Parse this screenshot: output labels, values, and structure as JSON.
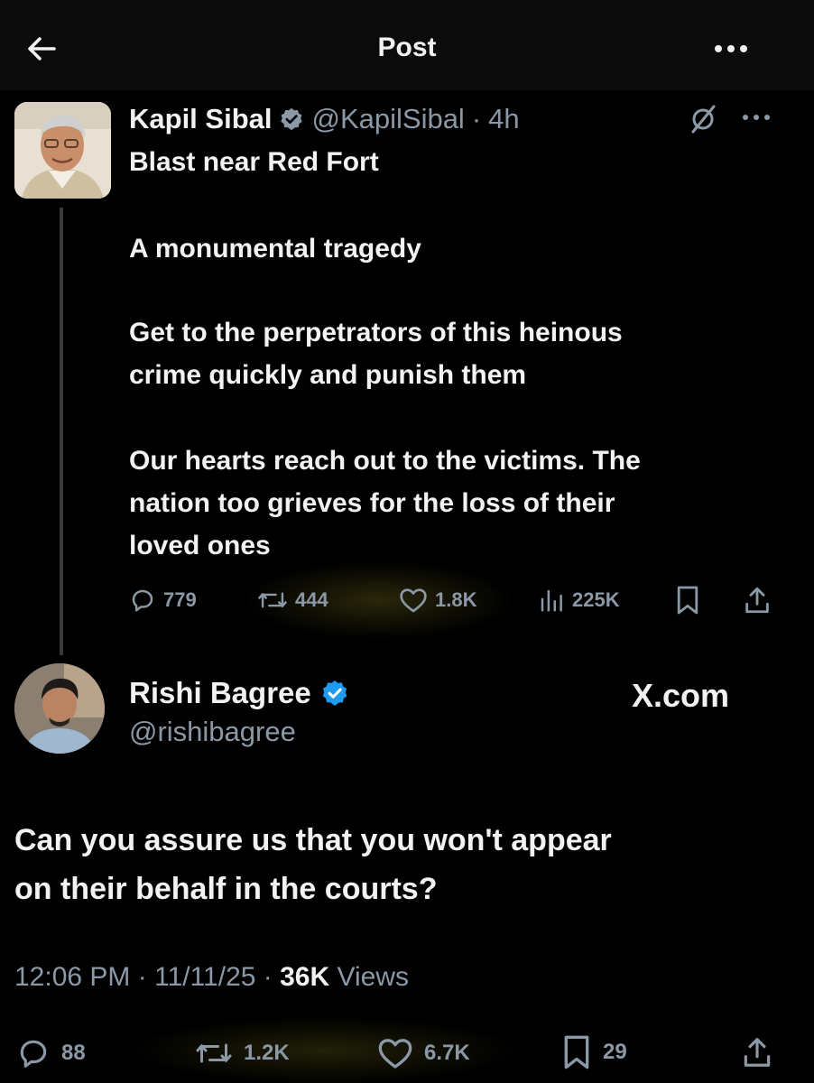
{
  "header": {
    "title": "Post"
  },
  "quoted_post": {
    "author_name": "Kapil Sibal",
    "handle": "@KapilSibal",
    "separator": "·",
    "time": "4h",
    "lines": [
      "Blast near Red Fort",
      "A monumental tragedy",
      "Get to the perpetrators of this heinous",
      "crime quickly and punish them",
      "Our hearts reach out to the victims. The",
      "nation too grieves for the loss of their",
      "loved ones"
    ],
    "actions": {
      "replies": "779",
      "reposts": "444",
      "likes": "1.8K",
      "views": "225K"
    },
    "accent_color": "#1d9bf0"
  },
  "reply_post": {
    "author_name": "Rishi Bagree",
    "handle": "@rishibagree",
    "watermark": "X.com",
    "lines": [
      "Can you assure us that you won't appear",
      "on their behalf in the courts?"
    ],
    "meta": {
      "time": "12:06 PM",
      "separator": "·",
      "date": "11/11/25",
      "views_count": "36K",
      "views_label": "Views"
    },
    "actions": {
      "replies": "88",
      "reposts": "1.2K",
      "likes": "6.7K",
      "bookmarks": "29"
    }
  },
  "icons": [
    "back-arrow-icon",
    "more-icon",
    "verified-badge-icon",
    "grok-icon",
    "reply-icon",
    "repost-icon",
    "like-icon",
    "views-icon",
    "bookmark-icon",
    "share-icon"
  ]
}
